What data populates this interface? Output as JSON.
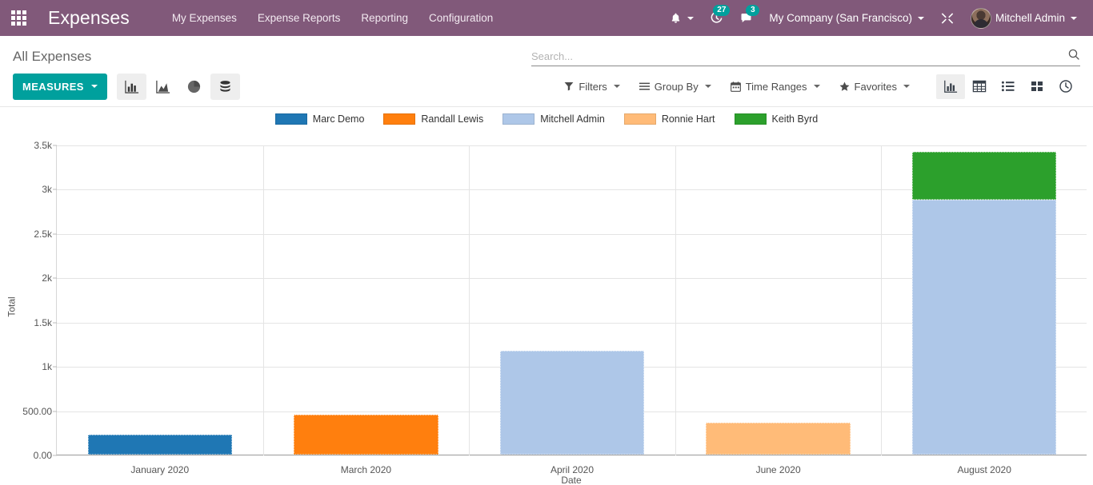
{
  "navbar": {
    "apps_icon": "apps-grid-icon",
    "brand": "Expenses",
    "menu": [
      {
        "label": "My Expenses"
      },
      {
        "label": "Expense Reports"
      },
      {
        "label": "Reporting"
      },
      {
        "label": "Configuration"
      }
    ],
    "bell_icon": "bell-icon",
    "activity_icon": "clock-activity-icon",
    "activity_count": "27",
    "messages_icon": "chat-bubble-icon",
    "messages_count": "3",
    "company": "My Company (San Francisco)",
    "debug_icon": "wrench-debug-icon",
    "user_name": "Mitchell Admin",
    "background_color": "#81597a"
  },
  "control_panel": {
    "breadcrumb": "All Expenses",
    "search": {
      "placeholder": "Search...",
      "value": "",
      "icon": "search-icon"
    },
    "measures_label": "MEASURES",
    "measures_color": "#00a09d",
    "chart_types": [
      {
        "name": "bar-chart-icon",
        "label": "Bar Chart",
        "active": true
      },
      {
        "name": "area-chart-icon",
        "label": "Line Chart",
        "active": false
      },
      {
        "name": "pie-chart-icon",
        "label": "Pie Chart",
        "active": false
      },
      {
        "name": "stacked-database-icon",
        "label": "Stacked",
        "active": true
      }
    ],
    "filters": [
      {
        "label": "Filters",
        "icon": "funnel-icon"
      },
      {
        "label": "Group By",
        "icon": "hamburger-icon"
      },
      {
        "label": "Time Ranges",
        "icon": "calendar-icon"
      },
      {
        "label": "Favorites",
        "icon": "star-icon"
      }
    ],
    "views": [
      {
        "name": "view-graph",
        "icon": "bar-chart-icon",
        "active": true
      },
      {
        "name": "view-pivot",
        "icon": "table-grid-icon",
        "active": false
      },
      {
        "name": "view-list",
        "icon": "list-icon",
        "active": false
      },
      {
        "name": "view-kanban",
        "icon": "kanban-icon",
        "active": false
      },
      {
        "name": "view-activity",
        "icon": "clock-icon",
        "active": false
      }
    ]
  },
  "chart_data": {
    "type": "bar",
    "stacked": true,
    "title": "",
    "xlabel": "Date",
    "ylabel": "Total",
    "ylim": [
      0,
      3500
    ],
    "grid": true,
    "legend_position": "top",
    "ytick_labels": [
      "0.00",
      "500.00",
      "1k",
      "1.5k",
      "2k",
      "2.5k",
      "3k",
      "3.5k"
    ],
    "ytick_values": [
      0,
      500,
      1000,
      1500,
      2000,
      2500,
      3000,
      3500
    ],
    "categories": [
      "January 2020",
      "March 2020",
      "April 2020",
      "June 2020",
      "August 2020"
    ],
    "series": [
      {
        "name": "Marc Demo",
        "color": "#1f77b4",
        "values": [
          230,
          0,
          0,
          0,
          0
        ]
      },
      {
        "name": "Randall Lewis",
        "color": "#ff7f0e",
        "values": [
          0,
          455,
          0,
          0,
          0
        ]
      },
      {
        "name": "Mitchell Admin",
        "color": "#aec7e8",
        "values": [
          0,
          0,
          1175,
          0,
          2880
        ]
      },
      {
        "name": "Ronnie Hart",
        "color": "#ffbb78",
        "values": [
          0,
          0,
          0,
          365,
          0
        ]
      },
      {
        "name": "Keith Byrd",
        "color": "#2ca02c",
        "values": [
          0,
          0,
          0,
          0,
          540
        ]
      }
    ]
  }
}
